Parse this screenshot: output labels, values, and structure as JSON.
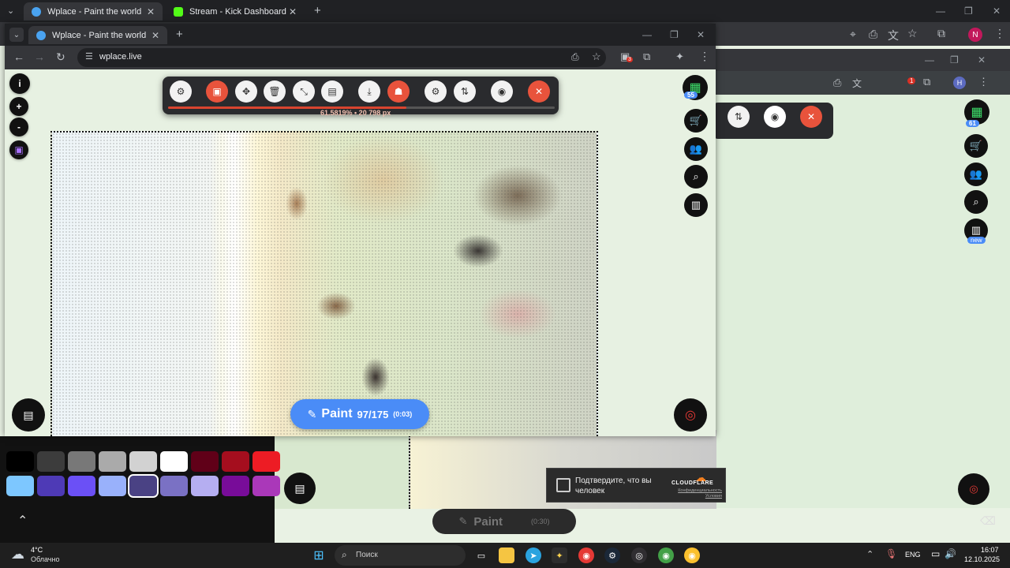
{
  "bg_browser": {
    "tabs": [
      {
        "label": "Wplace - Paint the world",
        "fav_color": "#4aa3f0"
      },
      {
        "label": "Stream - Kick Dashboard",
        "fav_color": "#53fc18"
      }
    ],
    "new_tab_symbol": "+",
    "profile_letter": "N"
  },
  "main_window": {
    "tab_label": "Wplace - Paint the world",
    "url": "wplace.live",
    "extension_badge": "3",
    "profile_level": "55",
    "progress_percent": 61.5819,
    "progress_text": "61.5819%  •  20 798 px",
    "paint": {
      "label": "Paint",
      "count": "97/175",
      "time": "(0:03)"
    },
    "map_zoom_in": "+",
    "map_zoom_out": "-",
    "info_symbol": "i"
  },
  "right_window": {
    "profile_letter": "H",
    "extension_badge": "1",
    "profile_level": "61",
    "leaderboard_badge": "new"
  },
  "behind_paint": {
    "label": "Paint",
    "time": "(0:30)"
  },
  "cloudflare": {
    "text": "Подтвердите, что вы человек",
    "brand": "CLOUDFLARE",
    "links": "Конфиденциальность Условия"
  },
  "palette_colors": [
    [
      "#000000",
      "#3c3c3c",
      "#787878",
      "#aaaaaa",
      "#d2d2d2",
      "#ffffff",
      "#600018",
      "#a50e1e",
      "#ed1c24"
    ],
    [
      "#7dc7ff",
      "#4e3ab6",
      "#6b50f6",
      "#99b1fb",
      "#4a4284",
      "#7a71c4",
      "#b5aef1",
      "#780c99",
      "#aa38b9"
    ]
  ],
  "taskbar": {
    "weather_temp": "4°C",
    "weather_desc": "Облачно",
    "search_placeholder": "Поиск",
    "language": "ENG",
    "time": "16:07",
    "date": "12.10.2025"
  }
}
